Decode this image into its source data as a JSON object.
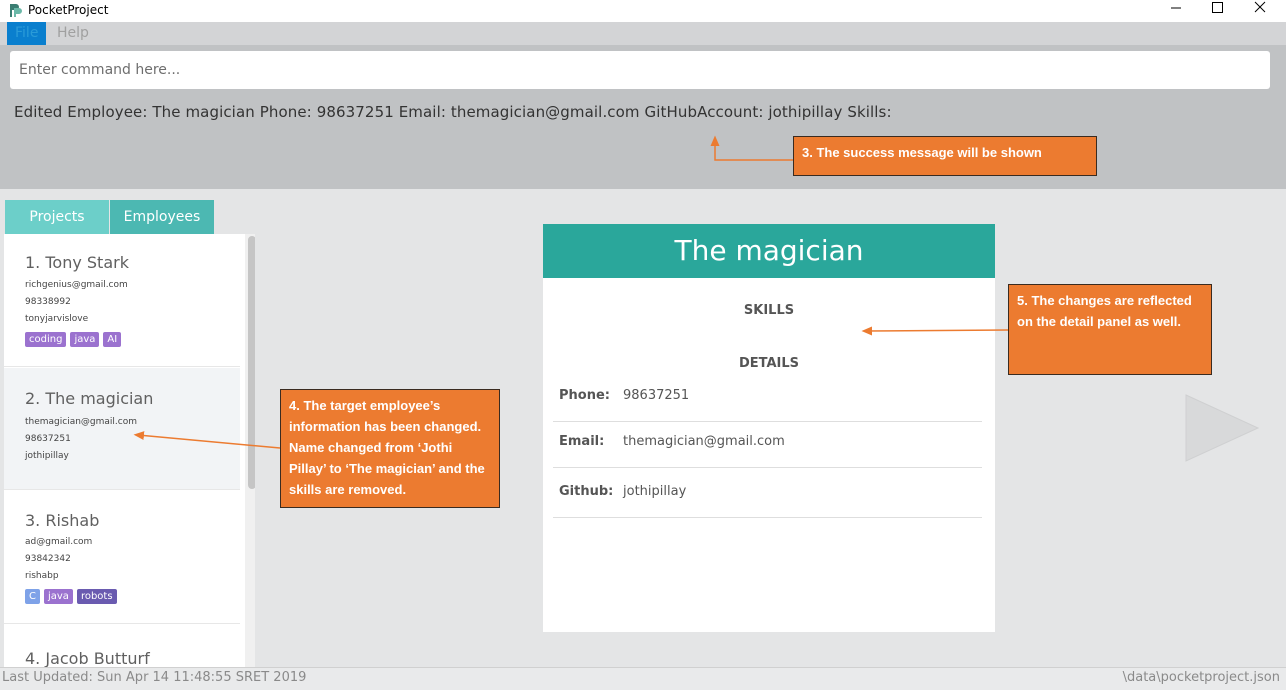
{
  "window": {
    "title": "PocketProject",
    "colors": {
      "accent": "#2aa79b",
      "annotation": "#ec7b30",
      "menu_active": "#0a7fce"
    }
  },
  "menu": {
    "file": "File",
    "help": "Help"
  },
  "command": {
    "placeholder": "Enter command here...",
    "value": ""
  },
  "result": {
    "message": "Edited Employee: The magician Phone: 98637251 Email: themagician@gmail.com GitHubAccount: jothipillay Skills:"
  },
  "tabs": {
    "projects": "Projects",
    "employees": "Employees"
  },
  "employees": [
    {
      "index_name": "1.  Tony Stark",
      "email": "richgenius@gmail.com",
      "phone": "98338992",
      "github": "tonyjarvislove",
      "tags": [
        {
          "label": "coding",
          "color": "#9b72cf"
        },
        {
          "label": "java",
          "color": "#9b72cf"
        },
        {
          "label": "AI",
          "color": "#9b72cf"
        }
      ]
    },
    {
      "index_name": "2.  The magician",
      "email": "themagician@gmail.com",
      "phone": "98637251",
      "github": "jothipillay",
      "tags": []
    },
    {
      "index_name": "3.  Rishab",
      "email": "ad@gmail.com",
      "phone": "93842342",
      "github": "rishabp",
      "tags": [
        {
          "label": "C",
          "color": "#7ea2e8"
        },
        {
          "label": "java",
          "color": "#9b72cf"
        },
        {
          "label": "robots",
          "color": "#6a5bb0"
        }
      ]
    },
    {
      "index_name": "4.  Jacob Butturf"
    }
  ],
  "detail": {
    "name": "The magician",
    "skills_title": "SKILLS",
    "details_title": "DETAILS",
    "rows": [
      {
        "label": "Phone:",
        "value": "98637251"
      },
      {
        "label": "Email:",
        "value": "themagician@gmail.com"
      },
      {
        "label": "Github:",
        "value": "jothipillay"
      }
    ]
  },
  "status": {
    "last_updated": "Last Updated: Sun Apr 14 11:48:55 SRET 2019",
    "file_path": "\\data\\pocketproject.json"
  },
  "annotations": {
    "a3": "3. The success message will be shown",
    "a4": "4. The target employee’s information has been changed. Name changed from ‘Jothi Pillay’ to ‘The magician’ and the skills are removed.",
    "a5": "5. The changes are reflected on the detail panel as well."
  }
}
